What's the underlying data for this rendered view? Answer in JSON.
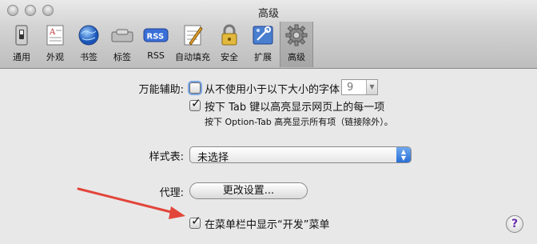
{
  "window": {
    "title": "高级"
  },
  "toolbar": {
    "items": [
      {
        "label": "通用",
        "icon": "switch-icon"
      },
      {
        "label": "外观",
        "icon": "appearance-icon"
      },
      {
        "label": "书签",
        "icon": "globe-icon"
      },
      {
        "label": "标签",
        "icon": "tabs-icon"
      },
      {
        "label": "RSS",
        "icon": "rss-icon"
      },
      {
        "label": "自动填充",
        "icon": "autofill-icon"
      },
      {
        "label": "安全",
        "icon": "lock-icon"
      },
      {
        "label": "扩展",
        "icon": "extensions-icon"
      },
      {
        "label": "高级",
        "icon": "gear-icon",
        "selected": true
      }
    ]
  },
  "accessibility": {
    "label": "万能辅助:",
    "min_font_option": "从不使用小于以下大小的字体",
    "min_font_value": "9",
    "tab_option": "按下 Tab 键以高亮显示网页上的每一项",
    "tab_hint": "按下 Option-Tab 高亮显示所有项（链接除外）。"
  },
  "stylesheet": {
    "label": "样式表:",
    "value": "未选择"
  },
  "proxy": {
    "label": "代理:",
    "button": "更改设置..."
  },
  "develop_menu": {
    "label": "在菜单栏中显示“开发”菜单"
  },
  "help": {
    "symbol": "?"
  },
  "colors": {
    "accent": "#2b6fd6",
    "annotation_arrow": "#e2453a"
  }
}
